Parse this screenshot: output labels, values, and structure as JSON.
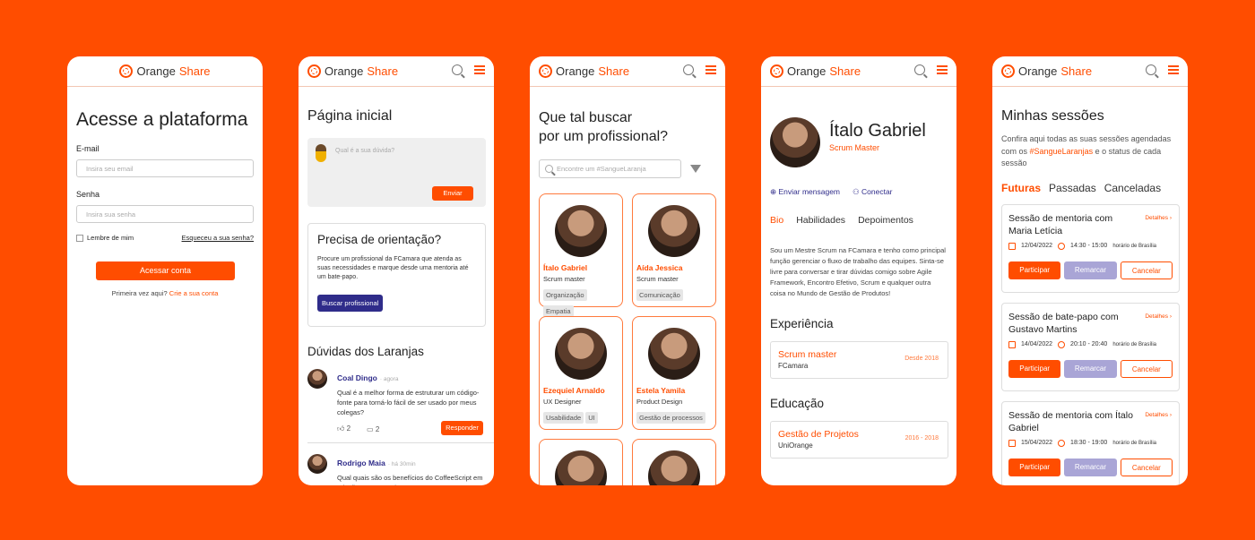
{
  "brand": {
    "word1": "Orange",
    "word2": "Share"
  },
  "login": {
    "title": "Acesse a plataforma",
    "email_label": "E-mail",
    "email_placeholder": "Insira seu email",
    "password_label": "Senha",
    "password_placeholder": "Insira sua senha",
    "remember": "Lembre de mim",
    "forgot": "Esqueceu a sua senha?",
    "submit": "Acessar conta",
    "first_time": "Primeira vez aqui?",
    "create": "Crie a sua conta"
  },
  "home": {
    "title": "Página inicial",
    "question_placeholder": "Qual é a sua dúvida?",
    "send": "Enviar",
    "card_title": "Precisa de orientação?",
    "card_text": "Procure um profissional da FCamara que atenda as suas necessidades e marque desde uma mentoria até um bate-papo.",
    "card_button": "Buscar profissional",
    "section_title": "Dúvidas dos Laranjas",
    "questions": [
      {
        "name": "Coal Dingo",
        "time": "· agora",
        "text": "Qual é a melhor forma de estruturar um código-fonte para torná-lo fácil de ser usado por meus colegas?",
        "likes": "2",
        "comments": "2",
        "reply": "Responder"
      },
      {
        "name": "Rodrigo Maia",
        "time": "· há 30min",
        "text": "Qual quais são os benefícios do CoffeeScript em relação ao JavaScript?"
      }
    ]
  },
  "search": {
    "title_line1": "Que tal buscar",
    "title_line2": "por um profissional?",
    "placeholder": "Encontre um #SangueLaranja",
    "people": [
      {
        "name": "Ítalo Gabriel",
        "role": "Scrum master",
        "tags": [
          "Organização",
          "Empatia"
        ]
      },
      {
        "name": "Aída Jessica",
        "role": "Scrum master",
        "tags": [
          "Comunicação"
        ]
      },
      {
        "name": "Ezequiel Arnaldo",
        "role": "UX Designer",
        "tags": [
          "Usabilidade",
          "UI"
        ]
      },
      {
        "name": "Estela Yamila",
        "role": "Product Design",
        "tags": [
          "Gestão de processos"
        ]
      },
      {
        "name": "",
        "role": "",
        "tags": []
      },
      {
        "name": "",
        "role": "",
        "tags": []
      }
    ]
  },
  "profile": {
    "name": "Ítalo Gabriel",
    "role": "Scrum Master",
    "send_message": "Enviar mensagem",
    "connect": "Conectar",
    "tabs": [
      "Bio",
      "Habilidades",
      "Depoimentos"
    ],
    "bio": "Sou um Mestre Scrum na FCamara e tenho como principal função gerenciar o fluxo de trabalho das equipes. Sinta-se livre para conversar e tirar dúvidas comigo sobre Agile Framework, Encontro Efetivo, Scrum e qualquer outra coisa no Mundo de Gestão de Produtos!",
    "experience_title": "Experiência",
    "experience": {
      "title": "Scrum master",
      "company": "FCamara",
      "date": "Desde 2018"
    },
    "education_title": "Educação",
    "education": {
      "title": "Gestão de Projetos",
      "school": "UniOrange",
      "date": "2016 - 2018"
    }
  },
  "sessions": {
    "title": "Minhas sessões",
    "desc_pre": "Confira aqui todas as suas sessões agendadas com os",
    "desc_tag": "#SangueLaranjas",
    "desc_post": "e o status de cada sessão",
    "tabs": [
      "Futuras",
      "Passadas",
      "Canceladas"
    ],
    "details": "Detalhes",
    "tz": "horário de Brasília",
    "join": "Participar",
    "reschedule": "Remarcar",
    "cancel": "Cancelar",
    "items": [
      {
        "title": "Sessão de mentoria com Maria Letícia",
        "date": "12/04/2022",
        "time": "14:30 - 15:00"
      },
      {
        "title": "Sessão de bate-papo com Gustavo Martins",
        "date": "14/04/2022",
        "time": "20:10 - 20:40"
      },
      {
        "title": "Sessão de mentoria com Ítalo Gabriel",
        "date": "15/04/2022",
        "time": "18:30 - 19:00"
      }
    ]
  }
}
